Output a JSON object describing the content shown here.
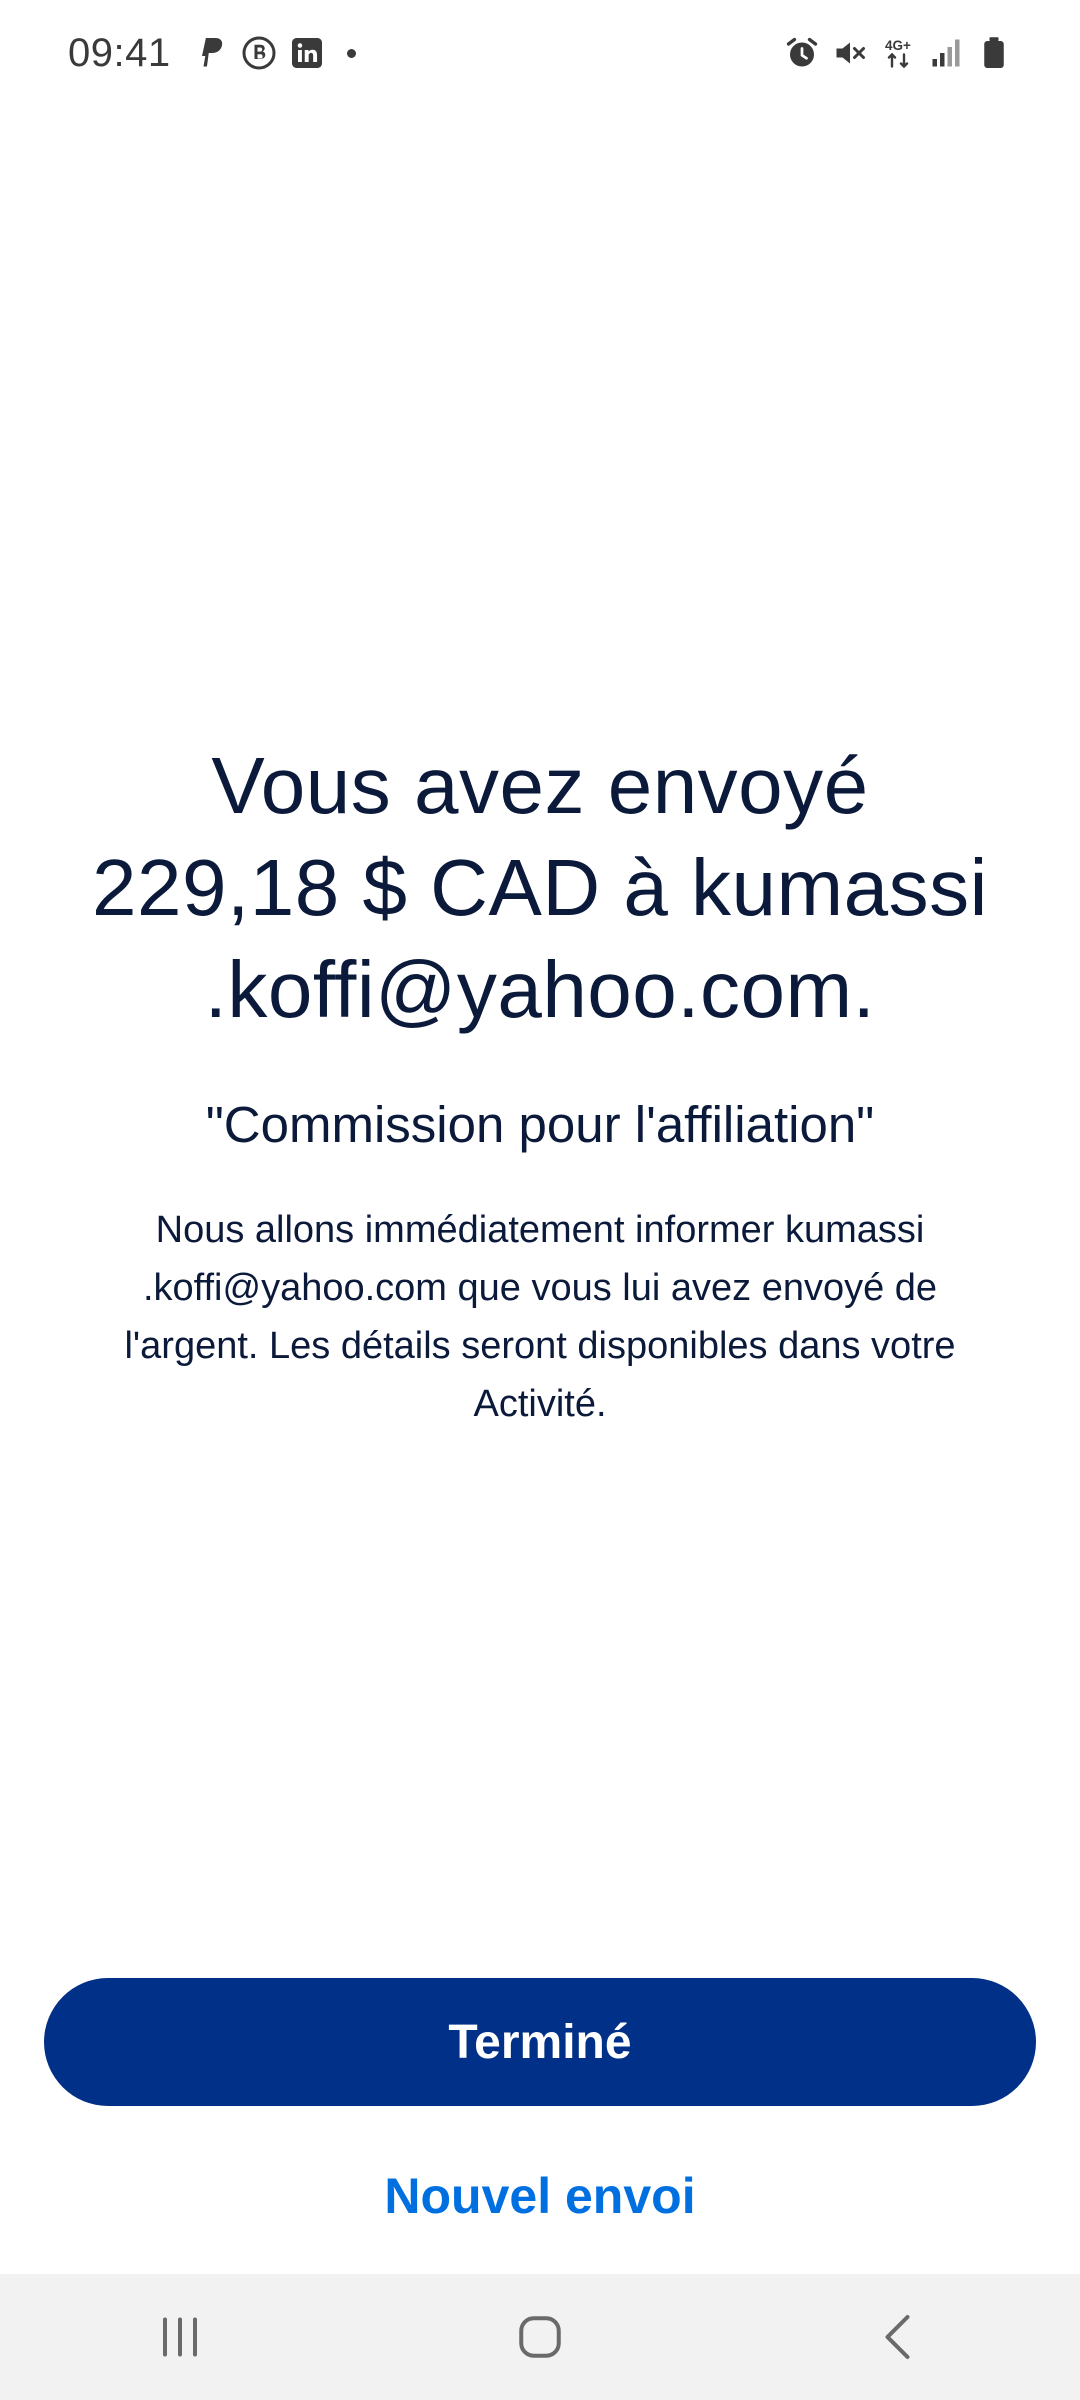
{
  "status_bar": {
    "time": "09:41",
    "left_icons": [
      "paypal-icon",
      "b-circle-icon",
      "linkedin-icon",
      "notification-dot-icon"
    ],
    "right_icons": [
      "alarm-icon",
      "mute-icon",
      "network-4g-icon",
      "signal-icon",
      "battery-icon"
    ],
    "network_label": "4G+"
  },
  "confirmation": {
    "headline_lines": [
      "Vous avez envoyé",
      "229,18 $ CAD à kumassi",
      ".koffi@yahoo.com."
    ],
    "note": "\"Commission pour l'affiliation\"",
    "info_lines": [
      "Nous allons immédiatement informer kumassi",
      ".koffi@yahoo.com que vous lui avez envoyé de",
      "l'argent. Les détails seront disponibles dans votre",
      "Activité."
    ]
  },
  "actions": {
    "done_label": "Terminé",
    "new_send_label": "Nouvel envoi"
  },
  "navigation": {
    "items": [
      "recent-apps-icon",
      "home-icon",
      "back-icon"
    ]
  },
  "colors": {
    "primary_button": "#003087",
    "link": "#0070e0",
    "text": "#0b1a3a",
    "nav_background": "#f2f2f2"
  }
}
